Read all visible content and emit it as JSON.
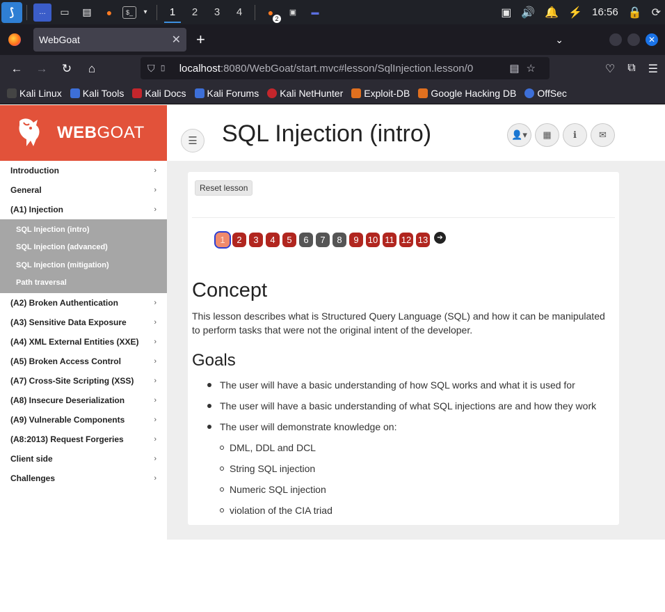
{
  "taskbar": {
    "workspaces": [
      "1",
      "2",
      "3",
      "4"
    ],
    "browser_badge": "2",
    "clock": "16:56"
  },
  "browser": {
    "tab_title": "WebGoat",
    "url_host": "localhost",
    "url_path": ":8080/WebGoat/start.mvc#lesson/SqlInjection.lesson/0",
    "bookmarks": [
      "Kali Linux",
      "Kali Tools",
      "Kali Docs",
      "Kali Forums",
      "Kali NetHunter",
      "Exploit-DB",
      "Google Hacking DB",
      "OffSec"
    ]
  },
  "brand": {
    "bold": "WEB",
    "light": "GOAT",
    "color": "#e2523a"
  },
  "header": {
    "title": "SQL Injection (intro)"
  },
  "sidebar": {
    "categories": [
      "Introduction",
      "General",
      "(A1) Injection",
      "(A2) Broken Authentication",
      "(A3) Sensitive Data Exposure",
      "(A4) XML External Entities (XXE)",
      "(A5) Broken Access Control",
      "(A7) Cross-Site Scripting (XSS)",
      "(A8) Insecure Deserialization",
      "(A9) Vulnerable Components",
      "(A8:2013) Request Forgeries",
      "Client side",
      "Challenges"
    ],
    "injection_sub": [
      "SQL Injection (intro)",
      "SQL Injection (advanced)",
      "SQL Injection (mitigation)",
      "Path traversal"
    ]
  },
  "lesson": {
    "reset_label": "Reset lesson",
    "pages": [
      "1",
      "2",
      "3",
      "4",
      "5",
      "6",
      "7",
      "8",
      "9",
      "10",
      "11",
      "12",
      "13"
    ],
    "concept_heading": "Concept",
    "concept_text": "This lesson describes what is Structured Query Language (SQL) and how it can be manipulated to perform tasks that were not the original intent of the developer.",
    "goals_heading": "Goals",
    "goals": [
      "The user will have a basic understanding of how SQL works and what it is used for",
      "The user will have a basic understanding of what SQL injections are and how they work",
      "The user will demonstrate knowledge on:"
    ],
    "knowledge": [
      "DML, DDL and DCL",
      "String SQL injection",
      "Numeric SQL injection",
      "violation of the CIA triad"
    ]
  }
}
